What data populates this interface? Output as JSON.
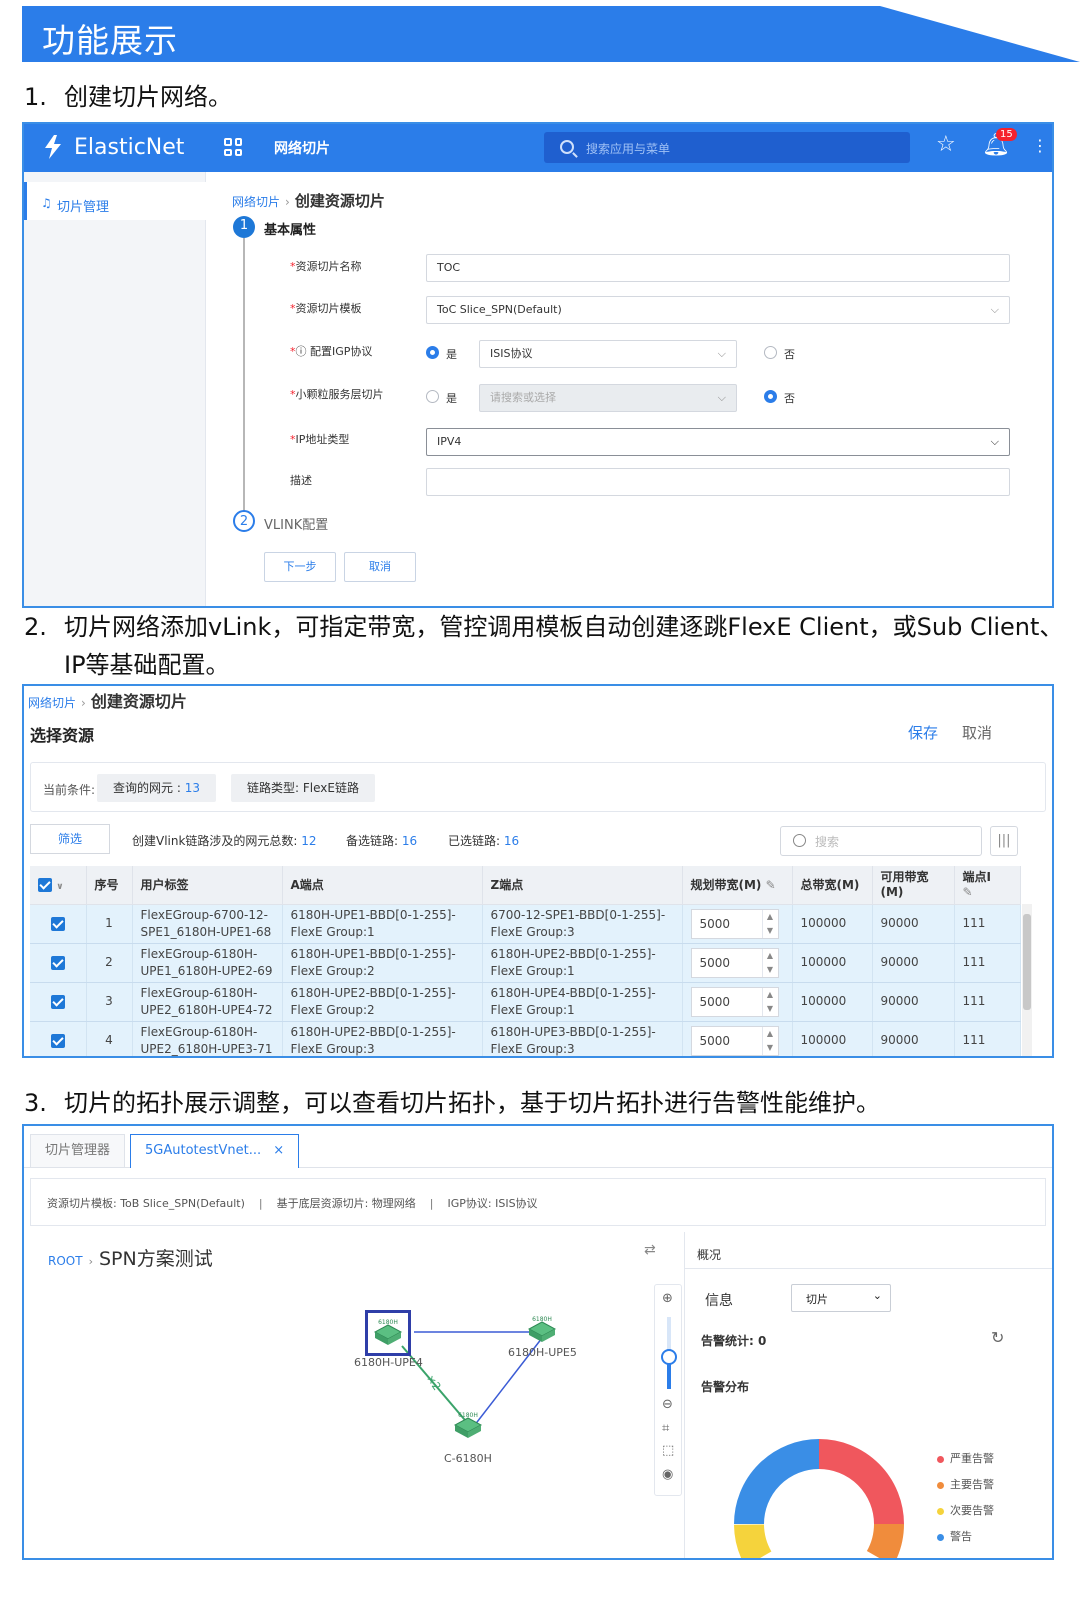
{
  "banner": {
    "title": "功能展示"
  },
  "steps": [
    {
      "num": "1.",
      "text": "创建切片网络。"
    },
    {
      "num": "2.",
      "text": "切片网络添加vLink，可指定带宽，管控调用模板自动创建逐跳FlexE Client，或Sub Client、",
      "text2": "IP等基础配置。"
    },
    {
      "num": "3.",
      "text": "切片的拓扑展示调整，可以查看切片拓扑，基于切片拓扑进行告警性能维护。"
    }
  ],
  "app": {
    "brand": "ElasticNet",
    "nav": "网络切片",
    "search_placeholder": "搜索应用与菜单",
    "notifications": "15",
    "sidebar_item": "切片管理"
  },
  "form": {
    "crumb_parent": "网络切片",
    "crumb_current": "创建资源切片",
    "step1": {
      "index": "1",
      "label": "基本属性"
    },
    "step2": {
      "index": "2",
      "label": "VLINK配置"
    },
    "fields": {
      "name_label": "资源切片名称",
      "name_value": "TOC",
      "template_label": "资源切片模板",
      "template_value": "ToC Slice_SPN(Default)",
      "igp_label": "配置IGP协议",
      "igp_yes": "是",
      "igp_protocol": "ISIS协议",
      "igp_no": "否",
      "small_label": "小颗粒服务层切片",
      "small_yes": "是",
      "small_placeholder": "请搜索或选择",
      "small_no": "否",
      "ip_label": "IP地址类型",
      "ip_value": "IPV4",
      "desc_label": "描述",
      "desc_value": ""
    },
    "buttons": {
      "next": "下一步",
      "cancel": "取消"
    }
  },
  "resources": {
    "crumb_parent": "网络切片",
    "crumb_current": "创建资源切片",
    "title": "选择资源",
    "save": "保存",
    "cancel": "取消",
    "condition_label": "当前条件:",
    "chip1_label": "查询的网元 : ",
    "chip1_value": "13",
    "chip2_label": "链路类型: FlexE链路",
    "filter": "筛选",
    "stat1_label": "创建Vlink链路涉及的网元总数: ",
    "stat1_value": "12",
    "stat2_label": "备选链路: ",
    "stat2_value": "16",
    "stat3_label": "已选链路: ",
    "stat3_value": "16",
    "search_placeholder": "搜索",
    "columns": {
      "index": "序号",
      "user_tag": "用户标签",
      "a_end": "A端点",
      "z_end": "Z端点",
      "planned_bw": "规划带宽(M)",
      "total_bw": "总带宽(M)",
      "avail_bw": "可用带宽(M)",
      "end_ip": "端点I"
    },
    "rows": [
      {
        "index": "1",
        "user_tag": "FlexEGroup-6700-12-SPE1_6180H-UPE1-68",
        "a_end": "6180H-UPE1-BBD[0-1-255]-FlexE Group:1",
        "z_end": "6700-12-SPE1-BBD[0-1-255]-FlexE Group:3",
        "planned_bw": "5000",
        "total_bw": "100000",
        "avail_bw": "90000",
        "end_ip": "111"
      },
      {
        "index": "2",
        "user_tag": "FlexEGroup-6180H-UPE1_6180H-UPE2-69",
        "a_end": "6180H-UPE1-BBD[0-1-255]-FlexE Group:2",
        "z_end": "6180H-UPE2-BBD[0-1-255]-FlexE Group:1",
        "planned_bw": "5000",
        "total_bw": "100000",
        "avail_bw": "90000",
        "end_ip": "111"
      },
      {
        "index": "3",
        "user_tag": "FlexEGroup-6180H-UPE2_6180H-UPE4-72",
        "a_end": "6180H-UPE2-BBD[0-1-255]-FlexE Group:2",
        "z_end": "6180H-UPE4-BBD[0-1-255]-FlexE Group:1",
        "planned_bw": "5000",
        "total_bw": "100000",
        "avail_bw": "90000",
        "end_ip": "111"
      },
      {
        "index": "4",
        "user_tag": "FlexEGroup-6180H-UPE2_6180H-UPE3-71",
        "a_end": "6180H-UPE2-BBD[0-1-255]-FlexE Group:3",
        "z_end": "6180H-UPE3-BBD[0-1-255]-FlexE Group:3",
        "planned_bw": "5000",
        "total_bw": "100000",
        "avail_bw": "90000",
        "end_ip": "111"
      }
    ]
  },
  "topology": {
    "tab1": "切片管理器",
    "tab2": "5GAutotestVnet...",
    "tab2_close": "×",
    "info1": "资源切片模板: ToB Slice_SPN(Default)",
    "info2": "基于底层资源切片: 物理网络",
    "info3": "IGP协议: ISIS协议",
    "root": "ROOT",
    "name": "SPN方案测试",
    "nodes": [
      {
        "name": "6180H-UPE4",
        "model": "6180H"
      },
      {
        "name": "6180H-UPE5",
        "model": "6180H"
      },
      {
        "name": "C-6180H",
        "model": "6180H"
      }
    ],
    "link_label": "×2",
    "panel": {
      "title": "概况",
      "info_label": "信息",
      "info_select": "切片",
      "alarm_stat": "告警统计: 0",
      "alarm_dist": "告警分布"
    },
    "legend": [
      {
        "label": "严重告警",
        "color": "#f0575d"
      },
      {
        "label": "主要告警",
        "color": "#f08c3c"
      },
      {
        "label": "次要告警",
        "color": "#f5d33c"
      },
      {
        "label": "警告",
        "color": "#3a8ee6"
      }
    ]
  }
}
